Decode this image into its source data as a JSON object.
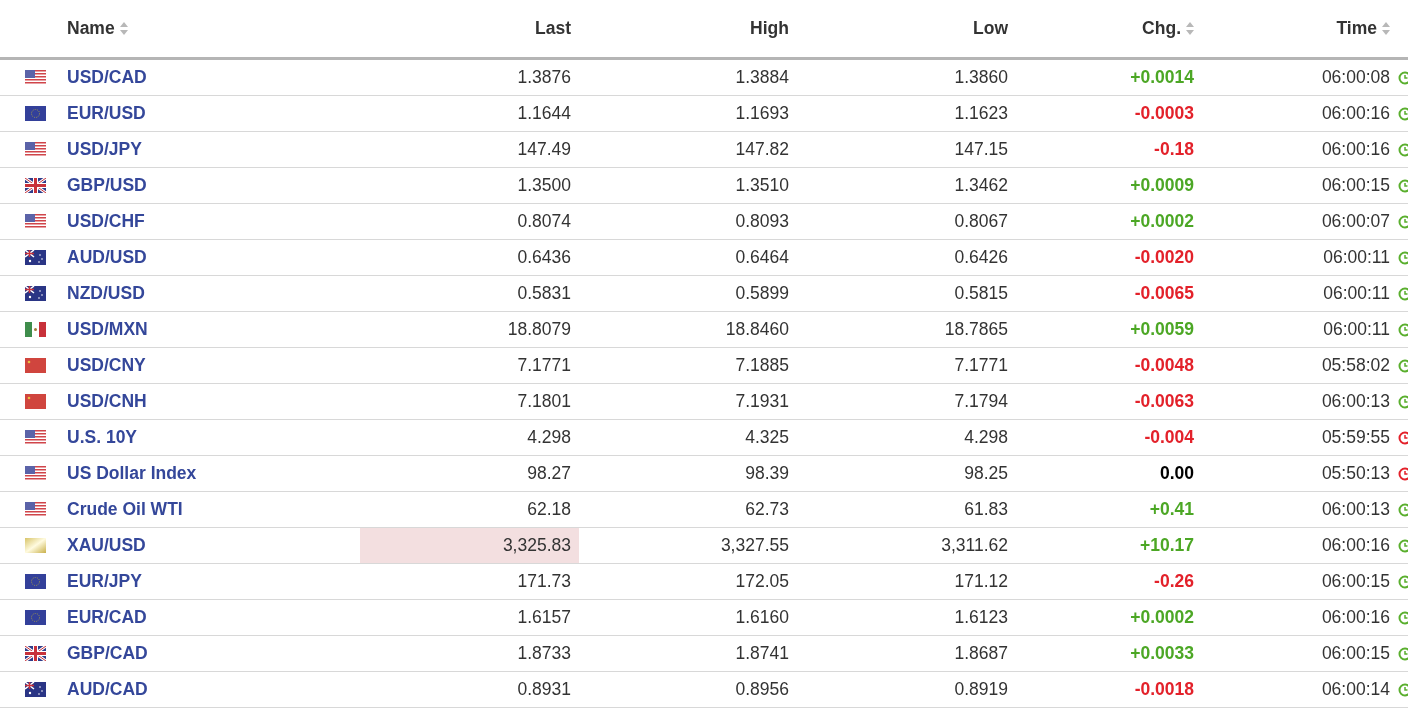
{
  "table": {
    "columns": [
      {
        "label": "Name",
        "sortable": true
      },
      {
        "label": "Last",
        "sortable": false
      },
      {
        "label": "High",
        "sortable": false
      },
      {
        "label": "Low",
        "sortable": false
      },
      {
        "label": "Chg.",
        "sortable": true
      },
      {
        "label": "Time",
        "sortable": true
      }
    ],
    "rows": [
      {
        "kind": "us",
        "name": "USD/CAD",
        "last": "1.3876",
        "high": "1.3884",
        "low": "1.3860",
        "chg": "+0.0014",
        "color": "#4ca725",
        "time": "06:00:08",
        "market_open": true,
        "highlighted": false
      },
      {
        "kind": "eu",
        "name": "EUR/USD",
        "last": "1.1644",
        "high": "1.1693",
        "low": "1.1623",
        "chg": "-0.0003",
        "color": "#e3212a",
        "time": "06:00:16",
        "market_open": true,
        "highlighted": false
      },
      {
        "kind": "us",
        "name": "USD/JPY",
        "last": "147.49",
        "high": "147.82",
        "low": "147.15",
        "chg": "-0.18",
        "color": "#e3212a",
        "time": "06:00:16",
        "market_open": true,
        "highlighted": false
      },
      {
        "kind": "gb",
        "name": "GBP/USD",
        "last": "1.3500",
        "high": "1.3510",
        "low": "1.3462",
        "chg": "+0.0009",
        "color": "#4ca725",
        "time": "06:00:15",
        "market_open": true,
        "highlighted": false
      },
      {
        "kind": "us",
        "name": "USD/CHF",
        "last": "0.8074",
        "high": "0.8093",
        "low": "0.8067",
        "chg": "+0.0002",
        "color": "#4ca725",
        "time": "06:00:07",
        "market_open": true,
        "highlighted": false
      },
      {
        "kind": "au",
        "name": "AUD/USD",
        "last": "0.6436",
        "high": "0.6464",
        "low": "0.6426",
        "chg": "-0.0020",
        "color": "#e3212a",
        "time": "06:00:11",
        "market_open": true,
        "highlighted": false
      },
      {
        "kind": "au",
        "name": "NZD/USD",
        "last": "0.5831",
        "high": "0.5899",
        "low": "0.5815",
        "chg": "-0.0065",
        "color": "#e3212a",
        "time": "06:00:11",
        "market_open": true,
        "highlighted": false
      },
      {
        "kind": "mx",
        "name": "USD/MXN",
        "last": "18.8079",
        "high": "18.8460",
        "low": "18.7865",
        "chg": "+0.0059",
        "color": "#4ca725",
        "time": "06:00:11",
        "market_open": true,
        "highlighted": false
      },
      {
        "kind": "cn",
        "name": "USD/CNY",
        "last": "7.1771",
        "high": "7.1885",
        "low": "7.1771",
        "chg": "-0.0048",
        "color": "#e3212a",
        "time": "05:58:02",
        "market_open": true,
        "highlighted": false
      },
      {
        "kind": "cn",
        "name": "USD/CNH",
        "last": "7.1801",
        "high": "7.1931",
        "low": "7.1794",
        "chg": "-0.0063",
        "color": "#e3212a",
        "time": "06:00:13",
        "market_open": true,
        "highlighted": false
      },
      {
        "kind": "us",
        "name": "U.S. 10Y",
        "last": "4.298",
        "high": "4.325",
        "low": "4.298",
        "chg": "-0.004",
        "color": "#e3212a",
        "time": "05:59:55",
        "market_open": false,
        "highlighted": false
      },
      {
        "kind": "us",
        "name": "US Dollar Index",
        "last": "98.27",
        "high": "98.39",
        "low": "98.25",
        "chg": "0.00",
        "color": "#000000",
        "time": "05:50:13",
        "market_open": false,
        "highlighted": false
      },
      {
        "kind": "us",
        "name": "Crude Oil WTI",
        "last": "62.18",
        "high": "62.73",
        "low": "61.83",
        "chg": "+0.41",
        "color": "#4ca725",
        "time": "06:00:13",
        "market_open": true,
        "highlighted": false
      },
      {
        "kind": "gold",
        "name": "XAU/USD",
        "last": "3,325.83",
        "high": "3,327.55",
        "low": "3,311.62",
        "chg": "+10.17",
        "color": "#4ca725",
        "time": "06:00:16",
        "market_open": true,
        "highlighted": true
      },
      {
        "kind": "eu",
        "name": "EUR/JPY",
        "last": "171.73",
        "high": "172.05",
        "low": "171.12",
        "chg": "-0.26",
        "color": "#e3212a",
        "time": "06:00:15",
        "market_open": true,
        "highlighted": false
      },
      {
        "kind": "eu",
        "name": "EUR/CAD",
        "last": "1.6157",
        "high": "1.6160",
        "low": "1.6123",
        "chg": "+0.0002",
        "color": "#4ca725",
        "time": "06:00:16",
        "market_open": true,
        "highlighted": false
      },
      {
        "kind": "gb",
        "name": "GBP/CAD",
        "last": "1.8733",
        "high": "1.8741",
        "low": "1.8687",
        "chg": "+0.0033",
        "color": "#4ca725",
        "time": "06:00:15",
        "market_open": true,
        "highlighted": false
      },
      {
        "kind": "au",
        "name": "AUD/CAD",
        "last": "0.8931",
        "high": "0.8956",
        "low": "0.8919",
        "chg": "-0.0018",
        "color": "#e3212a",
        "time": "06:00:14",
        "market_open": true,
        "highlighted": false
      }
    ]
  }
}
